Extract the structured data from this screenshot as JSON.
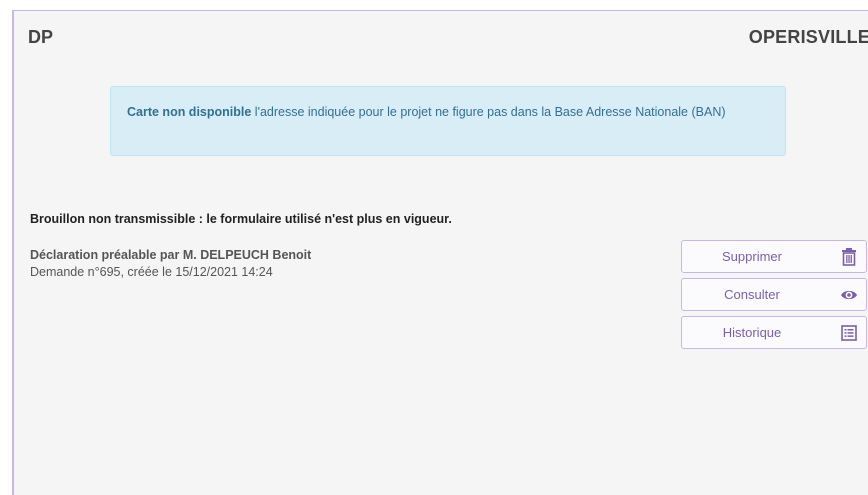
{
  "header": {
    "left_title": "DP",
    "right_title": "OPERISVILLE"
  },
  "alert": {
    "strong": "Carte non disponible",
    "text": " l'adresse indiquée pour le projet ne figure pas dans la Base Adresse Nationale (BAN)"
  },
  "draft_note": "Brouillon non transmissible : le formulaire utilisé n'est plus en vigueur.",
  "declaration": {
    "title": "Déclaration préalable par M. DELPEUCH Benoit",
    "subtitle": "Demande n°695, créée le 15/12/2021 14:24"
  },
  "actions": [
    {
      "label": "Supprimer",
      "icon": "trash-icon"
    },
    {
      "label": "Consulter",
      "icon": "eye-icon"
    },
    {
      "label": "Historique",
      "icon": "list-icon"
    }
  ],
  "colors": {
    "accent": "#7b5fae",
    "border": "#c8b7e6",
    "alert_bg": "#d9edf7",
    "alert_text": "#31708f"
  }
}
